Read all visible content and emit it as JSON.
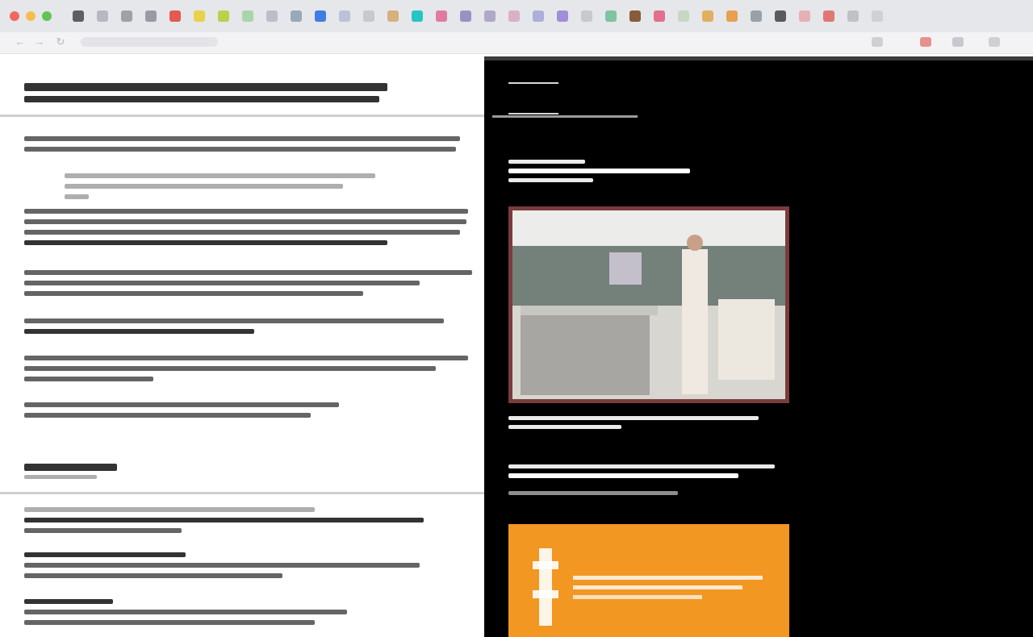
{
  "browser": {
    "tab_colors": [
      "#5f5f5f",
      "#b8b8c4",
      "#a0a0a8",
      "#9a9aa6",
      "#e45a4e",
      "#e8d24c",
      "#bcd04a",
      "#a8d6a8",
      "#b7c0c8",
      "#9aa8b8",
      "#3f7ee0",
      "#b9c2d8",
      "#c8c8d0",
      "#d7b07e",
      "#26c4c4",
      "#e07aa4",
      "#9494c4",
      "#b0a8c8",
      "#d9b0c8",
      "#aab0d8",
      "#a08ed8",
      "#c8c8d0",
      "#7ec4a0",
      "#8a5a3a",
      "#e0708c",
      "#c8d8c0",
      "#e0b060",
      "#e8a050",
      "#9aa0a8",
      "#5a5a5a",
      "#e8b0b0",
      "#e07870",
      "#c0c0c8",
      "#d0d0d8"
    ],
    "traffic_colors": [
      "#ee6a5e",
      "#f5bd4f",
      "#61c454"
    ],
    "toolbar_icon_colors": [
      "#d0d0d4",
      "#e89090",
      "#c8c8d0",
      "#d0d0d4"
    ]
  },
  "document": {},
  "sidebar_right": {
    "photo_colors": {
      "ceiling": "#ececea",
      "wall": "#74807a",
      "counter": "#a8a6a2",
      "figure": "#efe9e2",
      "frame": "#7a3c3c"
    },
    "banner_color": "#f29722"
  }
}
